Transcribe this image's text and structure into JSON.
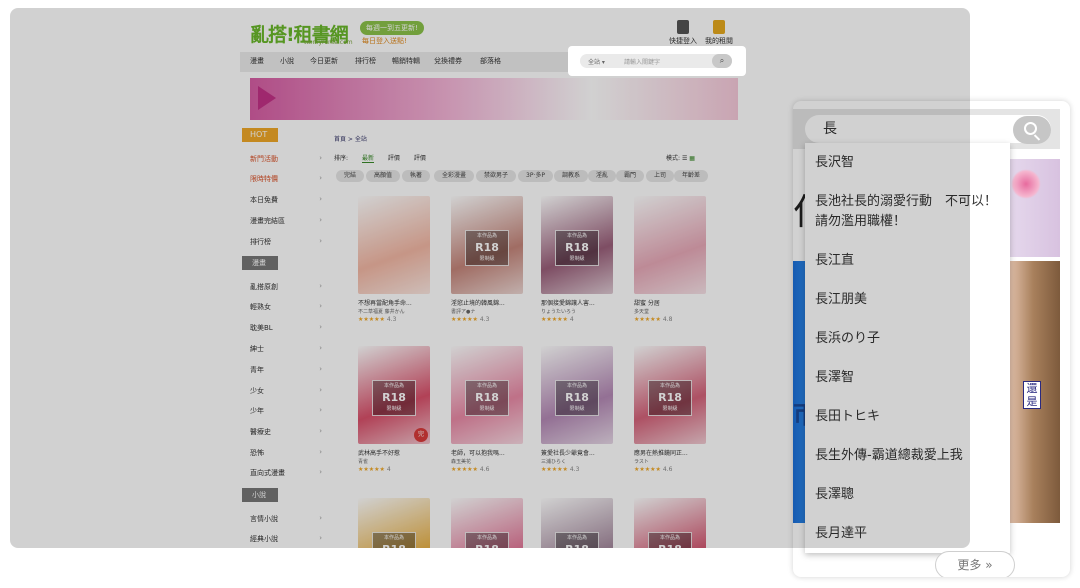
{
  "site": {
    "logo_text": "亂搭!租書網",
    "logo_url": "tw.myrenta.com",
    "pill_a": "每週一到五更新!",
    "pill_b": "每日登入送點!",
    "header_icons": [
      {
        "label": "快捷登入"
      },
      {
        "label": "我的租閱"
      }
    ],
    "nav": [
      "漫畫",
      "小說",
      "今日更新",
      "排行榜",
      "暢銷特輯",
      "兌換禮券",
      "部落格"
    ],
    "search": {
      "category": "全站 ▾",
      "placeholder": "請輸入關鍵字",
      "button_icon": "search-icon"
    },
    "sidebar": {
      "hot_tag": "HOT",
      "hot_items": [
        "新門活動",
        "限時特價",
        "本日免費",
        "漫畫完結區",
        "排行榜"
      ],
      "manga_head": "漫畫",
      "manga_items": [
        "亂搭原創",
        "輕熟女",
        "耽美BL",
        "紳士",
        "青年",
        "少女",
        "少年",
        "醫療史",
        "恐怖",
        "直向式漫畫"
      ],
      "novel_head": "小說",
      "novel_items": [
        "言情小說",
        "經典小說"
      ]
    },
    "breadcrumb": "首頁 > 全站",
    "sort": {
      "label": "排序:",
      "options": [
        "最新",
        "評價",
        "評價"
      ],
      "active": "最新"
    },
    "view_label": "模式:",
    "filters": [
      "完結",
      "高顏值",
      "執著",
      "全彩漫畫",
      "禁欲男子",
      "3P·多P",
      "調教系",
      "淫亂",
      "霸門",
      "上司",
      "年齡差"
    ],
    "books": [
      {
        "title": "不想再當配角手命...",
        "author": "不二草福夏 藤井かん",
        "rating": "4.3",
        "r18": false,
        "color": "#f2b7a4",
        "done": false
      },
      {
        "title": "淫慾止境的韓風錦...",
        "author": "書評ア●ナ",
        "rating": "4.3",
        "r18": true,
        "color": "#c4857a",
        "done": false
      },
      {
        "title": "那個接愛錦讓人害...",
        "author": "りょうたいろう",
        "rating": "4",
        "r18": true,
        "color": "#9a5f7a",
        "done": false
      },
      {
        "title": "甜蜜 分居",
        "author": "多天堂",
        "rating": "4.8",
        "r18": false,
        "color": "#e7a9b8",
        "done": false
      },
      {
        "title": "武林高手不好惹",
        "author": "青雀",
        "rating": "4",
        "r18": true,
        "color": "#d8506a",
        "done": true
      },
      {
        "title": "老師，可以抱我嗎...",
        "author": "森玉美花",
        "rating": "4.6",
        "r18": true,
        "color": "#e98aa6",
        "done": false
      },
      {
        "title": "簽愛社長少爺竟會...",
        "author": "三浦ひらく",
        "rating": "4.3",
        "r18": true,
        "color": "#b489b5",
        "done": false
      },
      {
        "title": "應男在熱推鏡同正...",
        "author": "ラスト",
        "rating": "4.6",
        "r18": true,
        "color": "#d4637a",
        "done": false
      },
      {
        "title": "",
        "author": "",
        "rating": "",
        "r18": true,
        "color": "#e8b24a",
        "done": false
      },
      {
        "title": "",
        "author": "",
        "rating": "",
        "r18": true,
        "color": "#e27a9a",
        "done": false
      },
      {
        "title": "",
        "author": "",
        "rating": "",
        "r18": true,
        "color": "#a58a9e",
        "done": false
      },
      {
        "title": "",
        "author": "",
        "rating": "",
        "r18": true,
        "color": "#d35b74",
        "done": false
      }
    ]
  },
  "panel": {
    "query": "長",
    "suggestions": [
      "長沢智",
      "長池社長的溺愛行動　不可以！請勿濫用職權！",
      "長江直",
      "長江朋美",
      "長浜のり子",
      "長澤智",
      "長田トヒキ",
      "長生外傳-霸道總裁愛上我",
      "長澤聰",
      "長月達平"
    ],
    "more_label": "更多 »",
    "art_tag": "還是"
  }
}
